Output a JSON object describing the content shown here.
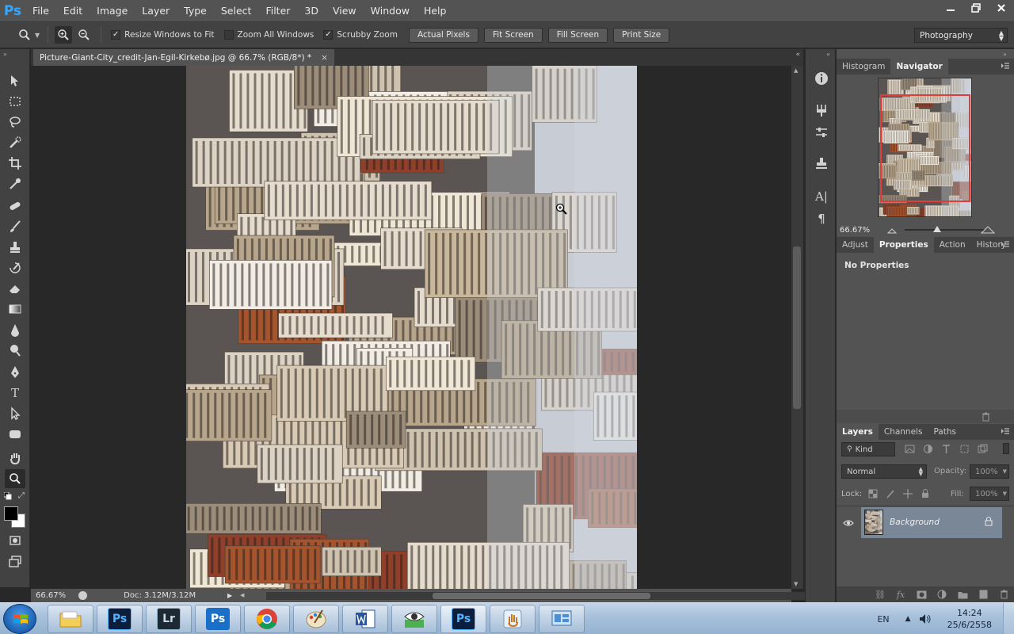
{
  "app": {
    "logo": "Ps"
  },
  "menu": [
    "File",
    "Edit",
    "Image",
    "Layer",
    "Type",
    "Select",
    "Filter",
    "3D",
    "View",
    "Window",
    "Help"
  ],
  "options": {
    "resize_windows": "Resize Windows to Fit",
    "zoom_all": "Zoom All Windows",
    "scrubby_zoom": "Scrubby Zoom",
    "actual_pixels": "Actual Pixels",
    "fit_screen": "Fit Screen",
    "fill_screen": "Fill Screen",
    "print_size": "Print Size",
    "workspace": "Photography"
  },
  "document": {
    "tab_title": "Picture-Giant-City_credit-Jan-Egil-Kirkebø.jpg @ 66.7% (RGB/8*) *",
    "close": "×",
    "zoom": "66.67%",
    "doc_size": "Doc: 3.12M/3.12M"
  },
  "navigator": {
    "tabs": [
      "Histogram",
      "Navigator"
    ],
    "zoom": "66.67%"
  },
  "properties": {
    "tabs": [
      "Adjust",
      "Properties",
      "Action",
      "History"
    ],
    "message": "No Properties"
  },
  "layers": {
    "tabs": [
      "Layers",
      "Channels",
      "Paths"
    ],
    "kind": "Kind",
    "blend_mode": "Normal",
    "opacity_label": "Opacity:",
    "opacity": "100%",
    "lock_label": "Lock:",
    "fill_label": "Fill:",
    "fill": "100%",
    "items": [
      {
        "name": "Background"
      }
    ]
  },
  "taskbar": {
    "apps": [
      "Lr",
      "Ps",
      "Ps"
    ],
    "lang": "EN",
    "time": "14:24",
    "date": "25/6/2558"
  }
}
